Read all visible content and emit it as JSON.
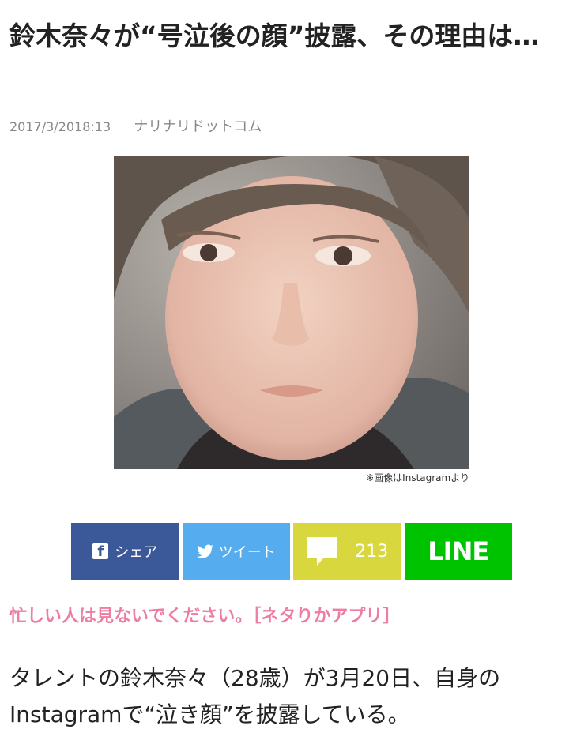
{
  "article": {
    "title": "鈴木奈々が“号泣後の顔”披露、その理由は…",
    "date": "2017/3/2018:13",
    "source": "ナリナリドットコム",
    "image_caption": "※画像はInstagramより",
    "body": "タレントの鈴木奈々（28歳）が3月20日、自身のInstagramで“泣き顔”を披露している。"
  },
  "share": {
    "facebook_label": "シェア",
    "twitter_label": "ツイート",
    "comment_count": "213",
    "line_label": "LINE"
  },
  "promo": {
    "text": "忙しい人は見ないでください。［ネタりかアプリ］"
  },
  "colors": {
    "facebook": "#3b5998",
    "twitter": "#55acee",
    "comments": "#d8d83e",
    "line": "#00c300",
    "promo": "#ee7ea1"
  },
  "icons": {
    "facebook": "facebook-icon",
    "twitter": "twitter-icon",
    "comment": "comment-bubble-icon"
  }
}
